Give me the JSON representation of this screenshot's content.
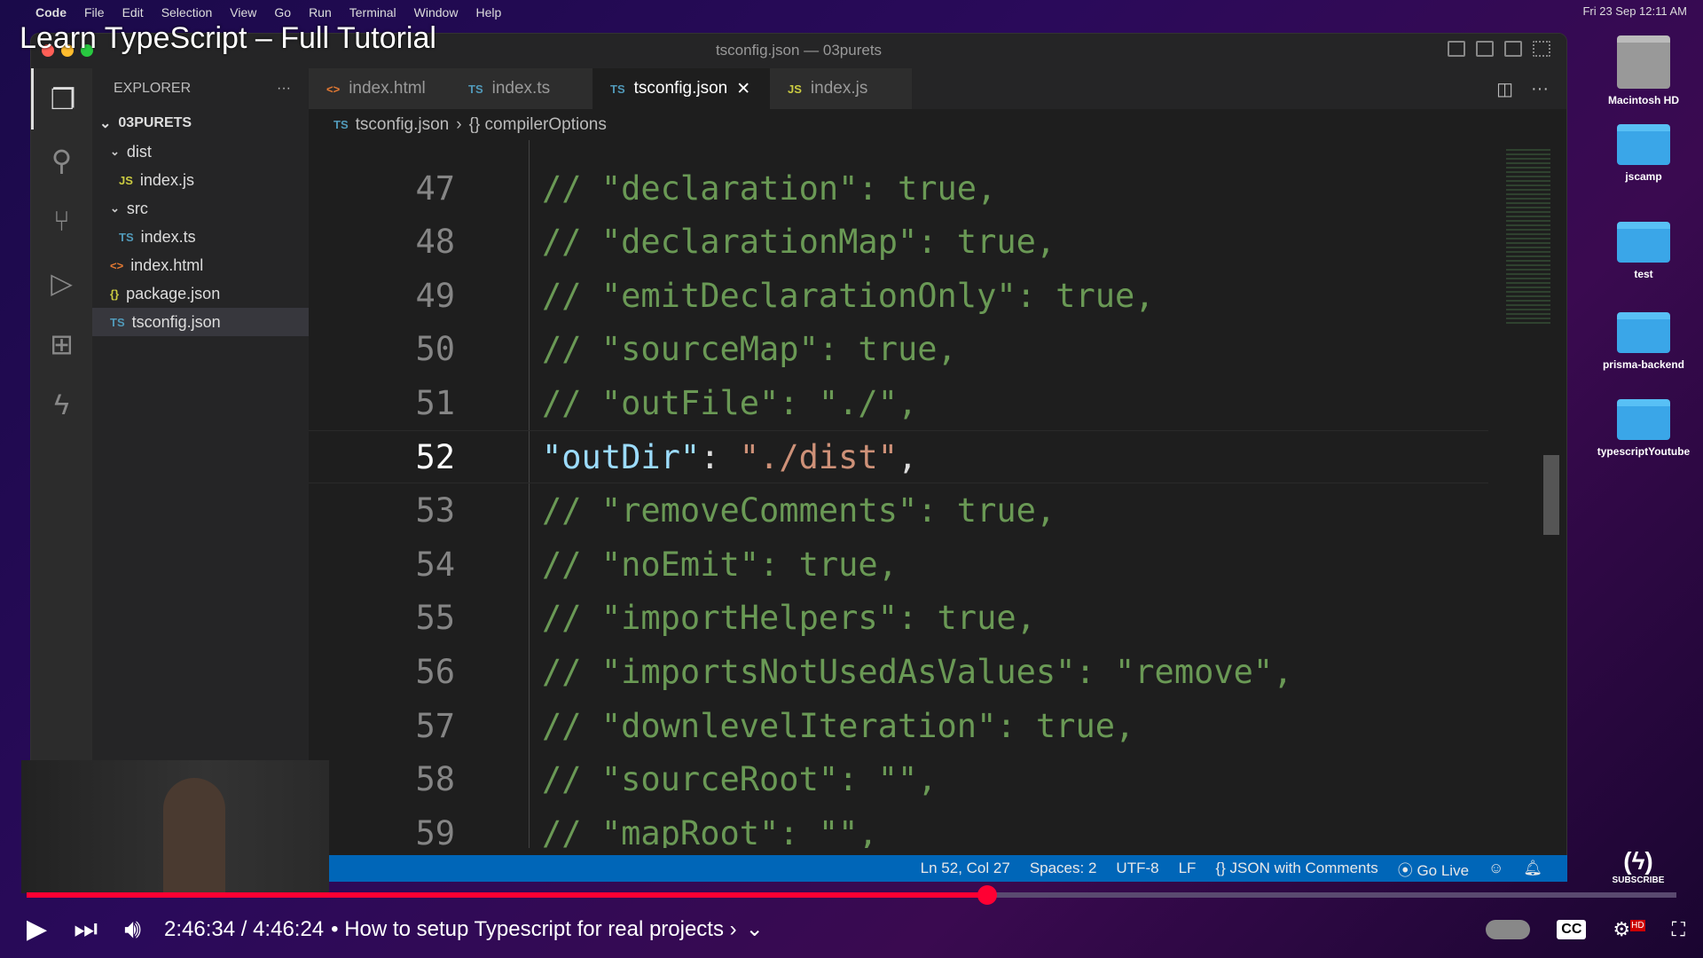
{
  "menubar": {
    "apple": "",
    "items": [
      "Code",
      "File",
      "Edit",
      "Selection",
      "View",
      "Go",
      "Run",
      "Terminal",
      "Window",
      "Help"
    ],
    "clock": "Fri 23 Sep 12:11 AM"
  },
  "video": {
    "title": "Learn TypeScript – Full Tutorial",
    "current_time": "2:46:34",
    "duration": "4:46:24",
    "time_sep": " / ",
    "chapter": "• How to setup Typescript for real projects ›",
    "progress": 0.582,
    "subscribe": "SUBSCRIBE",
    "hd": "HD",
    "cc": "CC"
  },
  "window": {
    "title": "tsconfig.json — 03purets"
  },
  "explorer": {
    "header": "EXPLORER",
    "more": "···",
    "root": "03PURETS",
    "items": [
      {
        "label": "dist",
        "type": "folder",
        "depth": 1,
        "icon": "⌄"
      },
      {
        "label": "index.js",
        "type": "js",
        "depth": 2,
        "icon": "JS"
      },
      {
        "label": "src",
        "type": "folder",
        "depth": 1,
        "icon": "⌄"
      },
      {
        "label": "index.ts",
        "type": "ts",
        "depth": 2,
        "icon": "TS"
      },
      {
        "label": "index.html",
        "type": "html",
        "depth": 1,
        "icon": "<>"
      },
      {
        "label": "package.json",
        "type": "json",
        "depth": 1,
        "icon": "{}"
      },
      {
        "label": "tsconfig.json",
        "type": "tsconfig",
        "depth": 1,
        "icon": "TS"
      }
    ]
  },
  "tabs": [
    {
      "label": "index.html",
      "icon": "<>"
    },
    {
      "label": "index.ts",
      "icon": "TS"
    },
    {
      "label": "tsconfig.json",
      "icon": "TS",
      "active": true,
      "close": "✕"
    },
    {
      "label": "index.js",
      "icon": "JS"
    }
  ],
  "breadcrumb": {
    "file": "tsconfig.json",
    "sep": "›",
    "symbol": "{} compilerOptions"
  },
  "editor": {
    "lines": [
      {
        "n": "47",
        "c": "// \"declaration\": true,"
      },
      {
        "n": "48",
        "c": "// \"declarationMap\": true,"
      },
      {
        "n": "49",
        "c": "// \"emitDeclarationOnly\": true,"
      },
      {
        "n": "50",
        "c": "// \"sourceMap\": true,"
      },
      {
        "n": "51",
        "c": "// \"outFile\": \"./\","
      },
      {
        "n": "52",
        "key": "\"outDir\"",
        "colon": ": ",
        "val": "\"./dist\"",
        "end": ",",
        "current": true
      },
      {
        "n": "53",
        "c": "// \"removeComments\": true,"
      },
      {
        "n": "54",
        "c": "// \"noEmit\": true,"
      },
      {
        "n": "55",
        "c": "// \"importHelpers\": true,"
      },
      {
        "n": "56",
        "c": "// \"importsNotUsedAsValues\": \"remove\","
      },
      {
        "n": "57",
        "c": "// \"downlevelIteration\": true,"
      },
      {
        "n": "58",
        "c": "// \"sourceRoot\": \"\","
      },
      {
        "n": "59",
        "c": "// \"mapRoot\": \"\","
      }
    ]
  },
  "statusbar": {
    "position": "Ln 52, Col 27",
    "spaces": "Spaces: 2",
    "encoding": "UTF-8",
    "eol": "LF",
    "language": "{} JSON with Comments",
    "golive": "Go Live"
  },
  "desktop": [
    {
      "label": "Macintosh HD"
    },
    {
      "label": "jscamp"
    },
    {
      "label": "test"
    },
    {
      "label": "prisma-backend"
    },
    {
      "label": "typescriptYoutube"
    }
  ]
}
